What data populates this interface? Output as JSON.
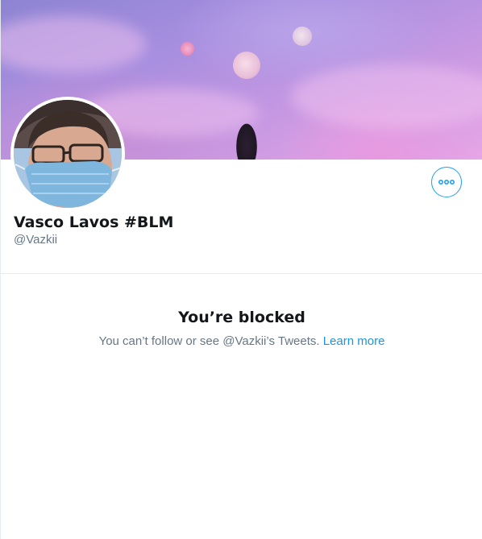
{
  "profile": {
    "name": "Vasco Lavos #BLM",
    "handle": "@Vazkii"
  },
  "more_button": {
    "icon": "more-icon"
  },
  "blocked": {
    "title": "You’re blocked",
    "message": "You can’t follow or see @Vazkii’s Tweets.",
    "learn_more": "Learn more"
  },
  "colors": {
    "accent": "#1da1f2",
    "link": "#1b95e0",
    "text_primary": "#14171a",
    "text_secondary": "#657786",
    "divider": "#e6ecf0"
  }
}
